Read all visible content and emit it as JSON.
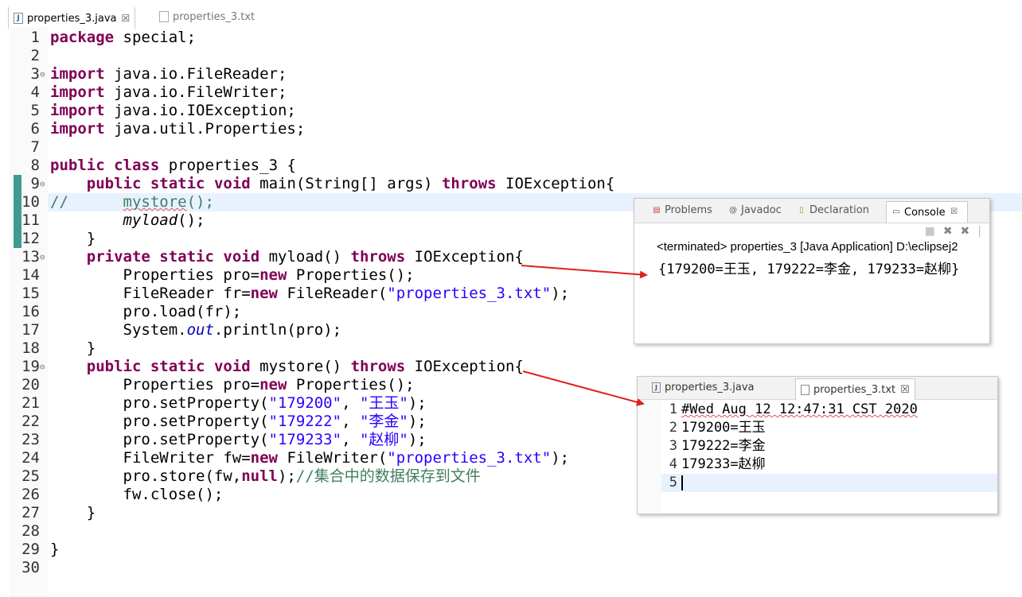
{
  "editor": {
    "tabs": [
      {
        "label": "properties_3.java",
        "close": "☒",
        "active": true
      },
      {
        "label": "properties_3.txt",
        "active": false
      }
    ],
    "lines": [
      {
        "n": "1"
      },
      {
        "n": "2"
      },
      {
        "n": "3"
      },
      {
        "n": "4"
      },
      {
        "n": "5"
      },
      {
        "n": "6"
      },
      {
        "n": "7"
      },
      {
        "n": "8"
      },
      {
        "n": "9"
      },
      {
        "n": "10"
      },
      {
        "n": "11"
      },
      {
        "n": "12"
      },
      {
        "n": "13"
      },
      {
        "n": "14"
      },
      {
        "n": "15"
      },
      {
        "n": "16"
      },
      {
        "n": "17"
      },
      {
        "n": "18"
      },
      {
        "n": "19"
      },
      {
        "n": "20"
      },
      {
        "n": "21"
      },
      {
        "n": "22"
      },
      {
        "n": "23"
      },
      {
        "n": "24"
      },
      {
        "n": "25"
      },
      {
        "n": "26"
      },
      {
        "n": "27"
      },
      {
        "n": "28"
      },
      {
        "n": "29"
      },
      {
        "n": "30"
      }
    ]
  },
  "console": {
    "tabs": {
      "problems": "Problems",
      "javadoc": "Javadoc",
      "declaration": "Declaration",
      "console": "Console",
      "close": "☒"
    },
    "terminated": "<terminated> properties_3 [Java Application] D:\\eclipsej2",
    "output": "{179200=王玉, 179222=李金, 179233=赵柳}"
  },
  "txt_editor": {
    "tabs": [
      {
        "label": "properties_3.java"
      },
      {
        "label": "properties_3.txt",
        "close": "☒"
      }
    ],
    "lines": [
      {
        "n": "1",
        "text": "#Wed Aug 12 12:47:31 CST 2020"
      },
      {
        "n": "2",
        "text": "179200=王玉"
      },
      {
        "n": "3",
        "text": "179222=李金"
      },
      {
        "n": "4",
        "text": "179233=赵柳"
      },
      {
        "n": "5",
        "text": ""
      }
    ]
  },
  "colors": {
    "keyword": "#7f0055",
    "string": "#2a00ff",
    "comment": "#3f7f5f",
    "field": "#0000c0",
    "current_line": "#e8f2fe",
    "arrow": "#e02020"
  }
}
